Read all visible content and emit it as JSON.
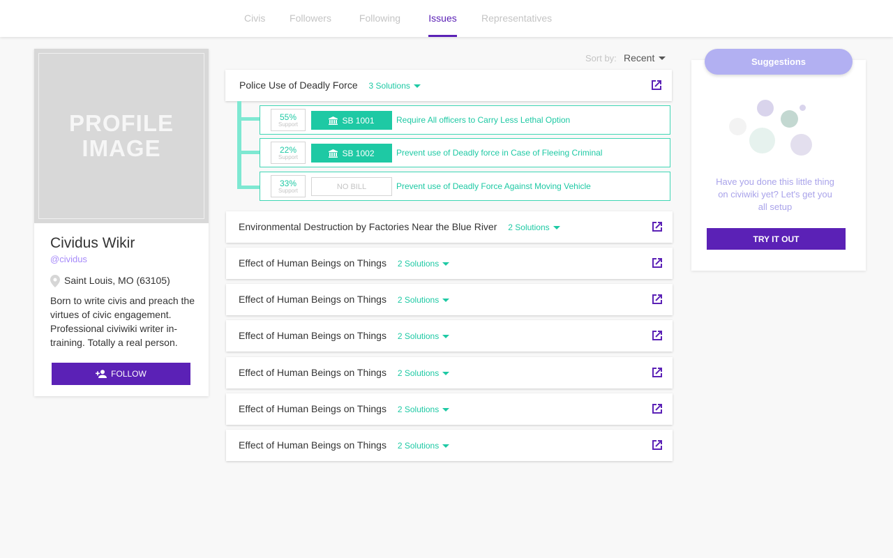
{
  "nav": {
    "tabs": [
      "Civis",
      "Followers",
      "Following",
      "Issues",
      "Representatives"
    ],
    "active": "Issues"
  },
  "profile": {
    "image_text": "PROFILE IMAGE",
    "name": "Cividus Wikir",
    "handle": "@cividus",
    "location": "Saint Louis, MO (63105)",
    "bio": "Born to write civis and preach the virtues of civic engagement. Professional civiwiki writer in-training. Totally a real person.",
    "follow_label": "FOLLOW",
    "icons": {
      "location": "map-pin-icon",
      "follow": "person-add-icon"
    }
  },
  "sort": {
    "label": "Sort by:",
    "value": "Recent"
  },
  "issues": [
    {
      "title": "Police Use of Deadly Force",
      "solutions_label": "3 Solutions",
      "expanded": true,
      "solutions": [
        {
          "percent": "55%",
          "support_label": "Support",
          "bill": "SB 1001",
          "text": "Require All officers to Carry Less Lethal Option"
        },
        {
          "percent": "22%",
          "support_label": "Support",
          "bill": "SB 1002",
          "text": "Prevent use of Deadly force in Case of Fleeing Criminal"
        },
        {
          "percent": "33%",
          "support_label": "Support",
          "bill": "NO BILL",
          "text": "Prevent use of Deadly Force Against Moving Vehicle"
        }
      ]
    },
    {
      "title": "Environmental Destruction by Factories Near the Blue River",
      "solutions_label": "2 Solutions"
    },
    {
      "title": "Effect of Human Beings on Things",
      "solutions_label": "2 Solutions"
    },
    {
      "title": "Effect of Human Beings on Things",
      "solutions_label": "2 Solutions"
    },
    {
      "title": "Effect of Human Beings on Things",
      "solutions_label": "2 Solutions"
    },
    {
      "title": "Effect of Human Beings on Things",
      "solutions_label": "2 Solutions"
    },
    {
      "title": "Effect of Human Beings on Things",
      "solutions_label": "2 Solutions"
    },
    {
      "title": "Effect of Human Beings on Things",
      "solutions_label": "2 Solutions"
    }
  ],
  "suggestions": {
    "title": "Suggestions",
    "text": "Have you done this little thing on civiwiki yet? Let's get you all setup",
    "button": "TRY IT OUT"
  },
  "colors": {
    "primary": "#5b21b6",
    "accent": "#1ec9a4",
    "muted": "#c4c4c4",
    "suggestion_pill": "#b2b0f2"
  }
}
